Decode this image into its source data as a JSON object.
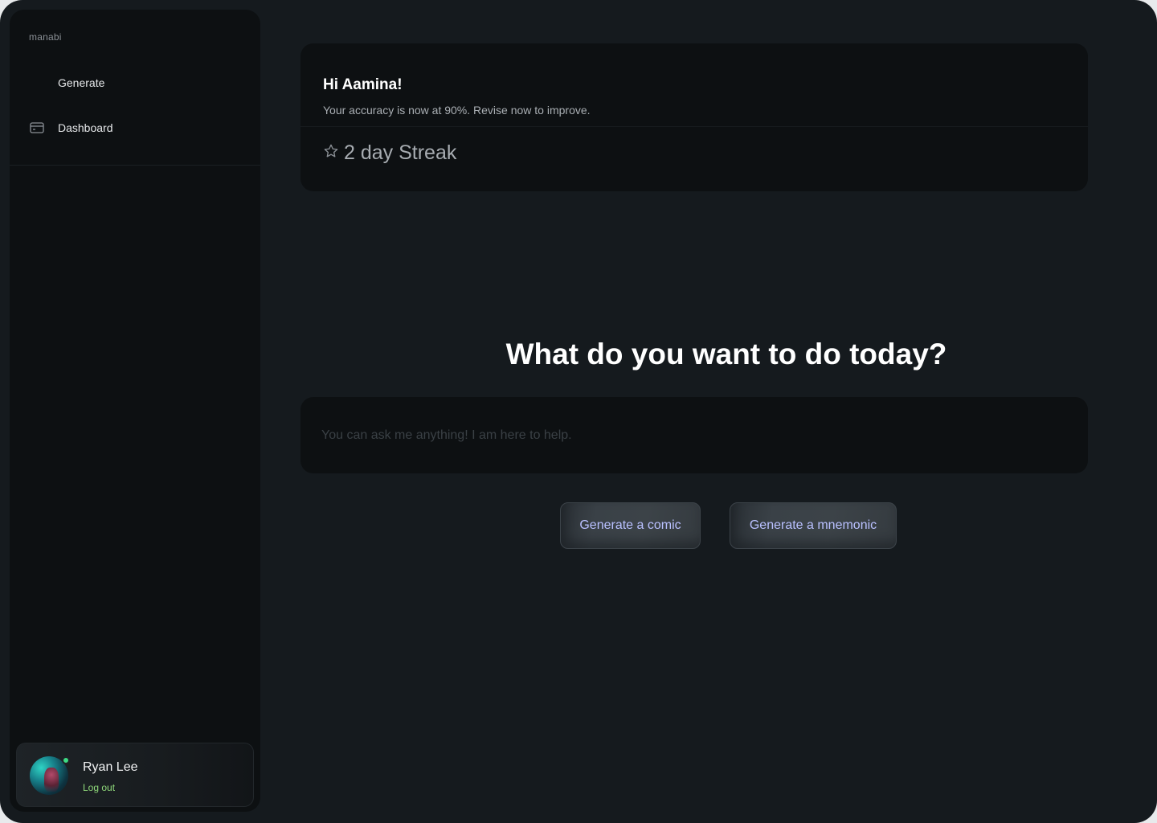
{
  "sidebar": {
    "brand": "manabi",
    "nav": [
      {
        "label": "Generate",
        "icon": "sparkle-icon"
      },
      {
        "label": "Dashboard",
        "icon": "card-icon"
      }
    ],
    "user": {
      "name": "Ryan Lee",
      "logout_label": "Log out",
      "status_color": "#3ddc84"
    }
  },
  "stats": {
    "greeting": "Hi Aamina!",
    "accuracy_text": "Your accuracy is now at  90%. Revise now to improve.",
    "streak_text": "2 day Streak",
    "streak_icon": "star-icon"
  },
  "main": {
    "headline": "What do you want to do today?",
    "prompt_placeholder": "You can ask me anything! I am here to help.",
    "actions": [
      {
        "label": "Generate a comic"
      },
      {
        "label": "Generate a mnemonic"
      }
    ]
  },
  "colors": {
    "background": "#151a1e",
    "panel": "#0d1012",
    "accent_text": "#b9c0ff",
    "logout": "#8fd87a"
  }
}
